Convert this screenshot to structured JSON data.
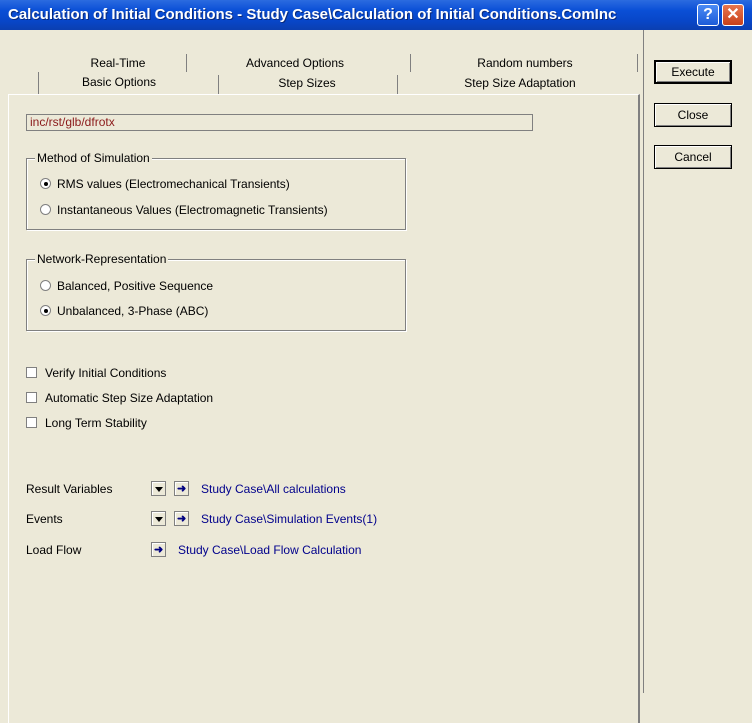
{
  "window": {
    "title": "Calculation of Initial Conditions - Study Case\\Calculation of Initial Conditions.ComInc",
    "help_glyph": "?",
    "close_glyph": "✕"
  },
  "tabs": {
    "row1": [
      "Real-Time",
      "Advanced Options",
      "Random numbers"
    ],
    "row2": [
      "Basic Options",
      "Step Sizes",
      "Step Size Adaptation"
    ],
    "active": "Basic Options"
  },
  "path_field": "inc/rst/glb/dfrotx",
  "method_group": {
    "legend": "Method of Simulation",
    "options": [
      "RMS values (Electromechanical Transients)",
      "Instantaneous Values (Electromagnetic Transients)"
    ],
    "selected": "RMS values (Electromechanical Transients)"
  },
  "network_group": {
    "legend": "Network-Representation",
    "options": [
      "Balanced, Positive Sequence",
      "Unbalanced, 3-Phase (ABC)"
    ],
    "selected": "Unbalanced, 3-Phase (ABC)"
  },
  "checkboxes": [
    {
      "label": "Verify Initial Conditions",
      "checked": false
    },
    {
      "label": "Automatic Step Size Adaptation",
      "checked": false
    },
    {
      "label": "Long Term Stability",
      "checked": false
    }
  ],
  "references": [
    {
      "label": "Result Variables",
      "value": "Study Case\\All calculations"
    },
    {
      "label": "Events",
      "value": "Study Case\\Simulation Events(1)"
    },
    {
      "label": "Load Flow",
      "value": "Study Case\\Load Flow Calculation"
    }
  ],
  "buttons": {
    "execute": "Execute",
    "close": "Close",
    "cancel": "Cancel"
  },
  "icons": {
    "dropdown": "chevron-down-icon",
    "jump": "arrow-right-icon"
  },
  "colors": {
    "title_bar": "#0a4fd6",
    "link": "#00008b",
    "path_text": "#8b1a1a",
    "background": "#ece9d8"
  }
}
